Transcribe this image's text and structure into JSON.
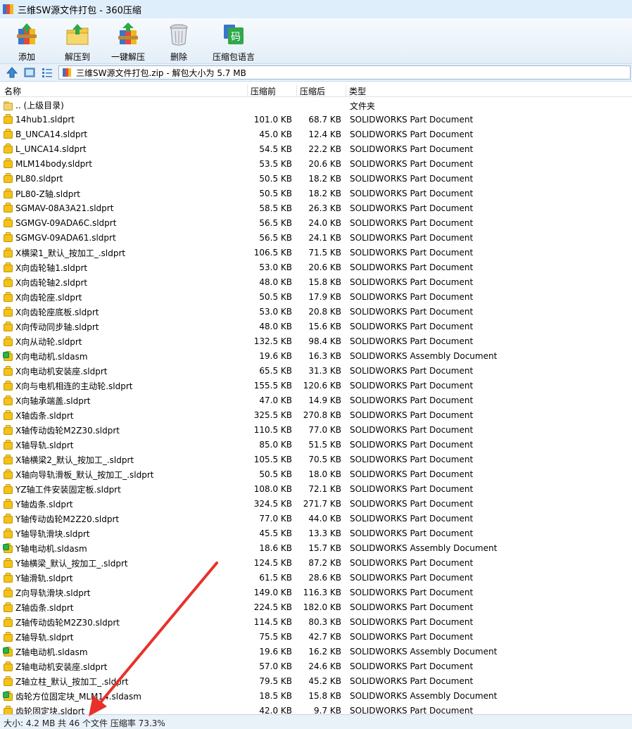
{
  "window": {
    "title": "三维SW源文件打包 - 360压缩"
  },
  "toolbar": [
    {
      "label": "添加",
      "icon": "add-archive-icon"
    },
    {
      "label": "解压到",
      "icon": "extract-folder-icon"
    },
    {
      "label": "一键解压",
      "icon": "one-click-extract-icon"
    },
    {
      "label": "删除",
      "icon": "trash-can-icon"
    },
    {
      "label": "压缩包语言",
      "icon": "archive-language-icon",
      "glyph": "码"
    }
  ],
  "address": {
    "path": "三维SW源文件打包.zip - 解包大小为 5.7 MB"
  },
  "columns": {
    "name": "名称",
    "size": "压缩前",
    "compressed": "压缩后",
    "type": "类型"
  },
  "parent_row": {
    "name": ".. (上级目录)",
    "type": "文件夹"
  },
  "files": [
    {
      "name": "14hub1.sldprt",
      "size": "101.0 KB",
      "compressed": "68.7 KB",
      "type": "SOLIDWORKS Part Document",
      "kind": "part"
    },
    {
      "name": "B_UNCA14.sldprt",
      "size": "45.0 KB",
      "compressed": "12.4 KB",
      "type": "SOLIDWORKS Part Document",
      "kind": "part"
    },
    {
      "name": "L_UNCA14.sldprt",
      "size": "54.5 KB",
      "compressed": "22.2 KB",
      "type": "SOLIDWORKS Part Document",
      "kind": "part"
    },
    {
      "name": "MLM14body.sldprt",
      "size": "53.5 KB",
      "compressed": "20.6 KB",
      "type": "SOLIDWORKS Part Document",
      "kind": "part"
    },
    {
      "name": "PL80.sldprt",
      "size": "50.5 KB",
      "compressed": "18.2 KB",
      "type": "SOLIDWORKS Part Document",
      "kind": "part"
    },
    {
      "name": "PL80-Z轴.sldprt",
      "size": "50.5 KB",
      "compressed": "18.2 KB",
      "type": "SOLIDWORKS Part Document",
      "kind": "part"
    },
    {
      "name": "SGMAV-08A3A21.sldprt",
      "size": "58.5 KB",
      "compressed": "26.3 KB",
      "type": "SOLIDWORKS Part Document",
      "kind": "part"
    },
    {
      "name": "SGMGV-09ADA6C.sldprt",
      "size": "56.5 KB",
      "compressed": "24.0 KB",
      "type": "SOLIDWORKS Part Document",
      "kind": "part"
    },
    {
      "name": "SGMGV-09ADA61.sldprt",
      "size": "56.5 KB",
      "compressed": "24.1 KB",
      "type": "SOLIDWORKS Part Document",
      "kind": "part"
    },
    {
      "name": "X横梁1_默认_按加工_.sldprt",
      "size": "106.5 KB",
      "compressed": "71.5 KB",
      "type": "SOLIDWORKS Part Document",
      "kind": "part"
    },
    {
      "name": "X向齿轮轴1.sldprt",
      "size": "53.0 KB",
      "compressed": "20.6 KB",
      "type": "SOLIDWORKS Part Document",
      "kind": "part"
    },
    {
      "name": "X向齿轮轴2.sldprt",
      "size": "48.0 KB",
      "compressed": "15.8 KB",
      "type": "SOLIDWORKS Part Document",
      "kind": "part"
    },
    {
      "name": "X向齿轮座.sldprt",
      "size": "50.5 KB",
      "compressed": "17.9 KB",
      "type": "SOLIDWORKS Part Document",
      "kind": "part"
    },
    {
      "name": "X向齿轮座底板.sldprt",
      "size": "53.0 KB",
      "compressed": "20.8 KB",
      "type": "SOLIDWORKS Part Document",
      "kind": "part"
    },
    {
      "name": "X向传动同步轴.sldprt",
      "size": "48.0 KB",
      "compressed": "15.6 KB",
      "type": "SOLIDWORKS Part Document",
      "kind": "part"
    },
    {
      "name": "X向从动轮.sldprt",
      "size": "132.5 KB",
      "compressed": "98.4 KB",
      "type": "SOLIDWORKS Part Document",
      "kind": "part"
    },
    {
      "name": "X向电动机.sldasm",
      "size": "19.6 KB",
      "compressed": "16.3 KB",
      "type": "SOLIDWORKS Assembly Document",
      "kind": "assembly"
    },
    {
      "name": "X向电动机安装座.sldprt",
      "size": "65.5 KB",
      "compressed": "31.3 KB",
      "type": "SOLIDWORKS Part Document",
      "kind": "part"
    },
    {
      "name": "X向与电机相连的主动轮.sldprt",
      "size": "155.5 KB",
      "compressed": "120.6 KB",
      "type": "SOLIDWORKS Part Document",
      "kind": "part"
    },
    {
      "name": "X向轴承端盖.sldprt",
      "size": "47.0 KB",
      "compressed": "14.9 KB",
      "type": "SOLIDWORKS Part Document",
      "kind": "part"
    },
    {
      "name": "X轴齿条.sldprt",
      "size": "325.5 KB",
      "compressed": "270.8 KB",
      "type": "SOLIDWORKS Part Document",
      "kind": "part"
    },
    {
      "name": "X轴传动齿轮M2Z30.sldprt",
      "size": "110.5 KB",
      "compressed": "77.0 KB",
      "type": "SOLIDWORKS Part Document",
      "kind": "part"
    },
    {
      "name": "X轴导轨.sldprt",
      "size": "85.0 KB",
      "compressed": "51.5 KB",
      "type": "SOLIDWORKS Part Document",
      "kind": "part"
    },
    {
      "name": "X轴横梁2_默认_按加工_.sldprt",
      "size": "105.5 KB",
      "compressed": "70.5 KB",
      "type": "SOLIDWORKS Part Document",
      "kind": "part"
    },
    {
      "name": "X轴向导轨滑板_默认_按加工_.sldprt",
      "size": "50.5 KB",
      "compressed": "18.0 KB",
      "type": "SOLIDWORKS Part Document",
      "kind": "part"
    },
    {
      "name": "YZ轴工件安装固定板.sldprt",
      "size": "108.0 KB",
      "compressed": "72.1 KB",
      "type": "SOLIDWORKS Part Document",
      "kind": "part"
    },
    {
      "name": "Y轴齿条.sldprt",
      "size": "324.5 KB",
      "compressed": "271.7 KB",
      "type": "SOLIDWORKS Part Document",
      "kind": "part"
    },
    {
      "name": "Y轴传动齿轮M2Z20.sldprt",
      "size": "77.0 KB",
      "compressed": "44.0 KB",
      "type": "SOLIDWORKS Part Document",
      "kind": "part"
    },
    {
      "name": "Y轴导轨滑块.sldprt",
      "size": "45.5 KB",
      "compressed": "13.3 KB",
      "type": "SOLIDWORKS Part Document",
      "kind": "part"
    },
    {
      "name": "Y轴电动机.sldasm",
      "size": "18.6 KB",
      "compressed": "15.7 KB",
      "type": "SOLIDWORKS Assembly Document",
      "kind": "assembly"
    },
    {
      "name": "Y轴横梁_默认_按加工_.sldprt",
      "size": "124.5 KB",
      "compressed": "87.2 KB",
      "type": "SOLIDWORKS Part Document",
      "kind": "part"
    },
    {
      "name": "Y轴滑轨.sldprt",
      "size": "61.5 KB",
      "compressed": "28.6 KB",
      "type": "SOLIDWORKS Part Document",
      "kind": "part"
    },
    {
      "name": "Z向导轨滑块.sldprt",
      "size": "149.0 KB",
      "compressed": "116.3 KB",
      "type": "SOLIDWORKS Part Document",
      "kind": "part"
    },
    {
      "name": "Z轴齿条.sldprt",
      "size": "224.5 KB",
      "compressed": "182.0 KB",
      "type": "SOLIDWORKS Part Document",
      "kind": "part"
    },
    {
      "name": "Z轴传动齿轮M2Z30.sldprt",
      "size": "114.5 KB",
      "compressed": "80.3 KB",
      "type": "SOLIDWORKS Part Document",
      "kind": "part"
    },
    {
      "name": "Z轴导轨.sldprt",
      "size": "75.5 KB",
      "compressed": "42.7 KB",
      "type": "SOLIDWORKS Part Document",
      "kind": "part"
    },
    {
      "name": "Z轴电动机.sldasm",
      "size": "19.6 KB",
      "compressed": "16.2 KB",
      "type": "SOLIDWORKS Assembly Document",
      "kind": "assembly"
    },
    {
      "name": "Z轴电动机安装座.sldprt",
      "size": "57.0 KB",
      "compressed": "24.6 KB",
      "type": "SOLIDWORKS Part Document",
      "kind": "part"
    },
    {
      "name": "Z轴立柱_默认_按加工_.sldprt",
      "size": "79.5 KB",
      "compressed": "45.2 KB",
      "type": "SOLIDWORKS Part Document",
      "kind": "part"
    },
    {
      "name": "齿轮方位固定块_MLM14.sldasm",
      "size": "18.5 KB",
      "compressed": "15.8 KB",
      "type": "SOLIDWORKS Assembly Document",
      "kind": "assembly"
    },
    {
      "name": "齿轮固定块.sldprt",
      "size": "42.0 KB",
      "compressed": "9.7 KB",
      "type": "SOLIDWORKS Part Document",
      "kind": "part"
    }
  ],
  "status": {
    "text": "大小: 4.2 MB 共 46 个文件 压缩率 73.3%"
  },
  "colors": {
    "arrow": "#e8312a",
    "folder": "#f2d46e",
    "part_icon": "#f3c21b",
    "assembly_badge": "#2bb24c"
  }
}
